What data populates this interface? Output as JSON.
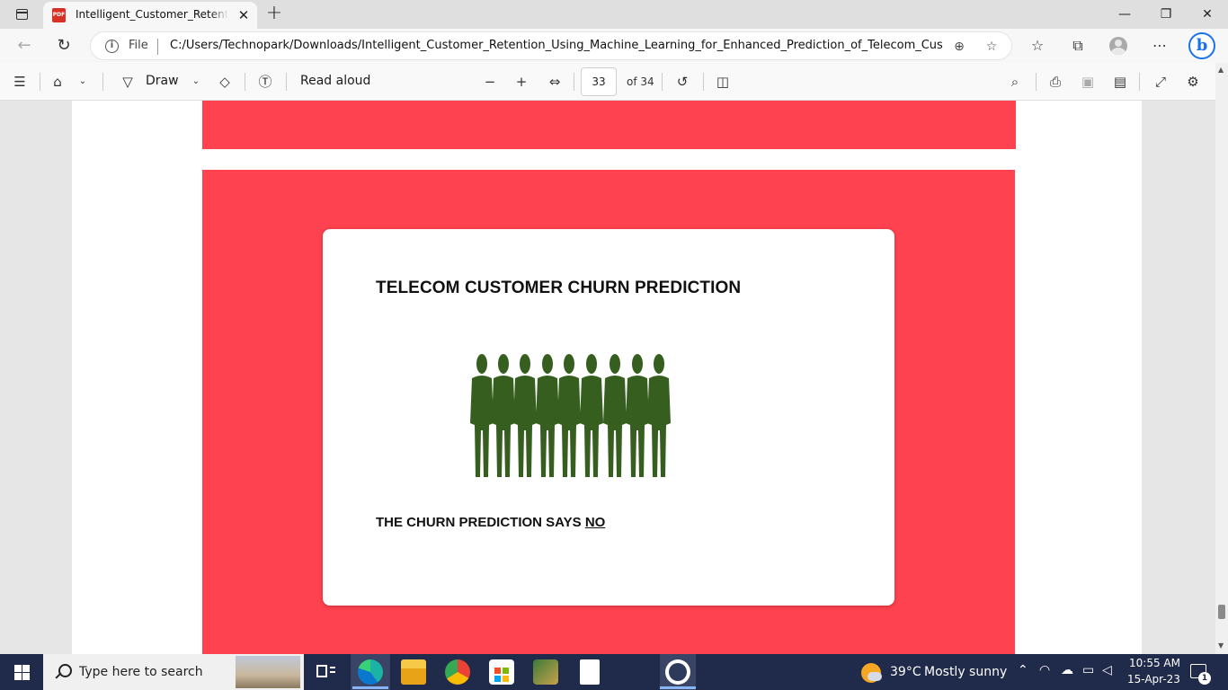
{
  "browser": {
    "tab": {
      "favicon_label": "PDF",
      "title": "Intelligent_Customer_Retention_Using_Machine_Learning",
      "close_glyph": "✕"
    },
    "new_tab_glyph": "+",
    "window_controls": {
      "minimize": "—",
      "maximize": "❐",
      "close": "✕"
    },
    "address": {
      "scheme_label": "File",
      "url": "C:/Users/Technopark/Downloads/Intelligent_Customer_Retention_Using_Machine_Learning_for_Enhanced_Prediction_of_Telecom_Custom..."
    },
    "icons": [
      "back-icon",
      "refresh-icon",
      "info-icon",
      "zoom-icon",
      "add-favorite-icon",
      "favorites-icon",
      "collections-icon",
      "profile-icon",
      "more-icon",
      "bing-icon"
    ]
  },
  "pdf_toolbar": {
    "draw_label": "Draw",
    "read_aloud_label": "Read aloud",
    "zoom_out": "−",
    "zoom_in": "+",
    "current_page": "33",
    "total_pages": "of 34"
  },
  "document": {
    "card_title": "TELECOM CUSTOMER CHURN PREDICTION",
    "result_prefix": "THE CHURN PREDICTION SAYS ",
    "result_value": "NO",
    "colors": {
      "panel": "#ff424f",
      "figure": "#355e1f"
    }
  },
  "taskbar": {
    "search_placeholder": "Type here to search",
    "weather_temp": "39°C",
    "weather_desc": "Mostly sunny",
    "time": "10:55 AM",
    "date": "15-Apr-23",
    "notification_count": "1"
  }
}
